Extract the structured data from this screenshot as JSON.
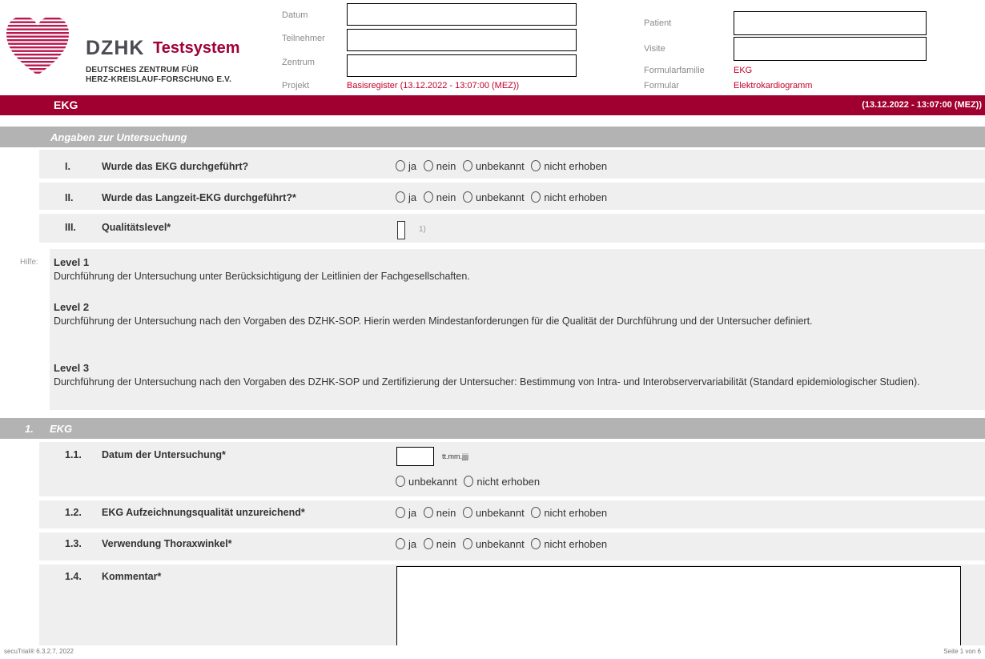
{
  "header": {
    "logo": {
      "abbr": "DZHK",
      "system": "Testsystem",
      "line1": "DEUTSCHES ZENTRUM FÜR",
      "line2": "HERZ-KREISLAUF-FORSCHUNG E.V."
    },
    "labels": {
      "datum": "Datum",
      "teilnehmer": "Teilnehmer",
      "zentrum": "Zentrum",
      "projekt": "Projekt",
      "patient": "Patient",
      "visite": "Visite",
      "formularfamilie": "Formularfamilie",
      "formular": "Formular"
    },
    "values": {
      "projekt": "Basisregister (13.12.2022 - 13:07:00 (MEZ))",
      "formularfamilie": "EKG",
      "formular": "Elektrokardiogramm"
    }
  },
  "titlebar": {
    "title": "EKG",
    "date": "(13.12.2022 - 13:07:00 (MEZ))"
  },
  "sections": {
    "s0": {
      "label": "Angaben zur Untersuchung"
    },
    "s1": {
      "num": "1.",
      "label": "EKG"
    }
  },
  "options": {
    "ja": "ja",
    "nein": "nein",
    "unbekannt": "unbekannt",
    "nicht_erhoben": "nicht erhoben"
  },
  "rows": {
    "r1": {
      "num": "I.",
      "label": "Wurde das EKG durchgeführt?"
    },
    "r2": {
      "num": "II.",
      "label": "Wurde das Langzeit-EKG durchgeführt?*"
    },
    "r3": {
      "num": "III.",
      "label": "Qualitätslevel*",
      "footnote": "1)"
    },
    "r11": {
      "num": "1.1.",
      "label": "Datum der Untersuchung*",
      "format": "tt.mm.jjjj"
    },
    "r12": {
      "num": "1.2.",
      "label": "EKG Aufzeichnungsqualität unzureichend*"
    },
    "r13": {
      "num": "1.3.",
      "label": "Verwendung Thoraxwinkel*"
    },
    "r14": {
      "num": "1.4.",
      "label": "Kommentar*"
    }
  },
  "help": {
    "label": "Hilfe:",
    "level1": {
      "title": "Level 1",
      "text": "Durchführung der Untersuchung unter Berücksichtigung der Leitlinien der Fachgesellschaften."
    },
    "level2": {
      "title": "Level 2",
      "text": "Durchführung der Untersuchung nach den Vorgaben des DZHK-SOP. Hierin werden Mindestanforderungen für die Qualität der Durchführung und der Untersucher definiert."
    },
    "level3": {
      "title": "Level 3",
      "text": "Durchführung der Untersuchung nach den Vorgaben des DZHK-SOP und Zertifizierung der Untersucher: Bestimmung von Intra- und Interobservervariabilität (Standard epidemiologischer Studien)."
    }
  },
  "footer": {
    "left": "secuTrial® 6.3.2.7, 2022",
    "right": "Seite 1 von 6"
  },
  "colors": {
    "brand": "#a0002f",
    "section": "#b3b3b3",
    "row": "#efefef",
    "red_text": "#c4002a"
  }
}
